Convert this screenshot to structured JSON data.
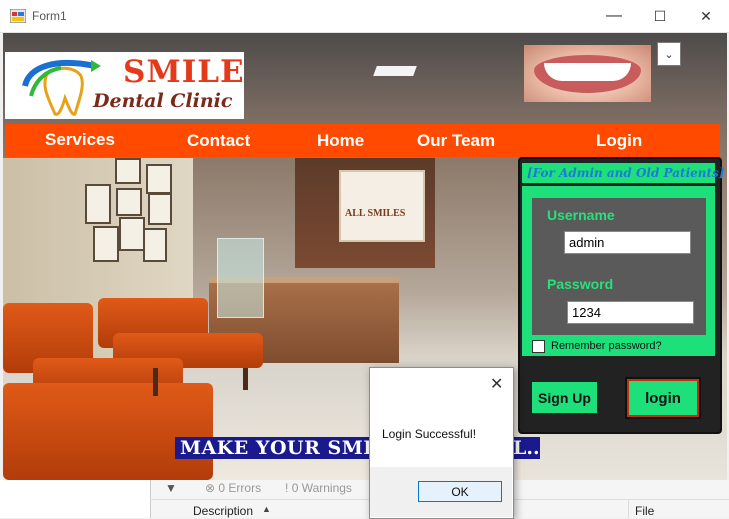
{
  "window": {
    "title": "Form1",
    "minimize": "—",
    "maximize": "☐",
    "close": "✕"
  },
  "logo": {
    "line1": "SMILE",
    "line2": "Dental Clinic"
  },
  "dropdown": {
    "arrow": "⌄"
  },
  "nav": {
    "items": [
      "Services",
      "Contact",
      "Home",
      "Our Team",
      "Login"
    ]
  },
  "login": {
    "header": "[For Admin and Old Patients]",
    "username_label": "Username",
    "username_value": "admin",
    "password_label": "Password",
    "password_value": "1234",
    "remember_label": "Remember password?",
    "signup_label": "Sign Up",
    "login_label": "login"
  },
  "banner": {
    "text": "MAKE YOUR SMIL"
  },
  "banner_tail": {
    "text": "L.."
  },
  "reception_sign": {
    "text": "ALL SMILES"
  },
  "error_list": {
    "errors": "0 Errors",
    "warnings": "0 Warnings",
    "col_description": "Description",
    "col_file": "File"
  },
  "message_box": {
    "text": "Login Successful!",
    "ok_label": "OK",
    "close": "✕"
  },
  "colors": {
    "nav": "#ff4a00",
    "accent_green": "#1de07a",
    "logo_red": "#e53a1a",
    "banner": "#1a1a8c"
  }
}
